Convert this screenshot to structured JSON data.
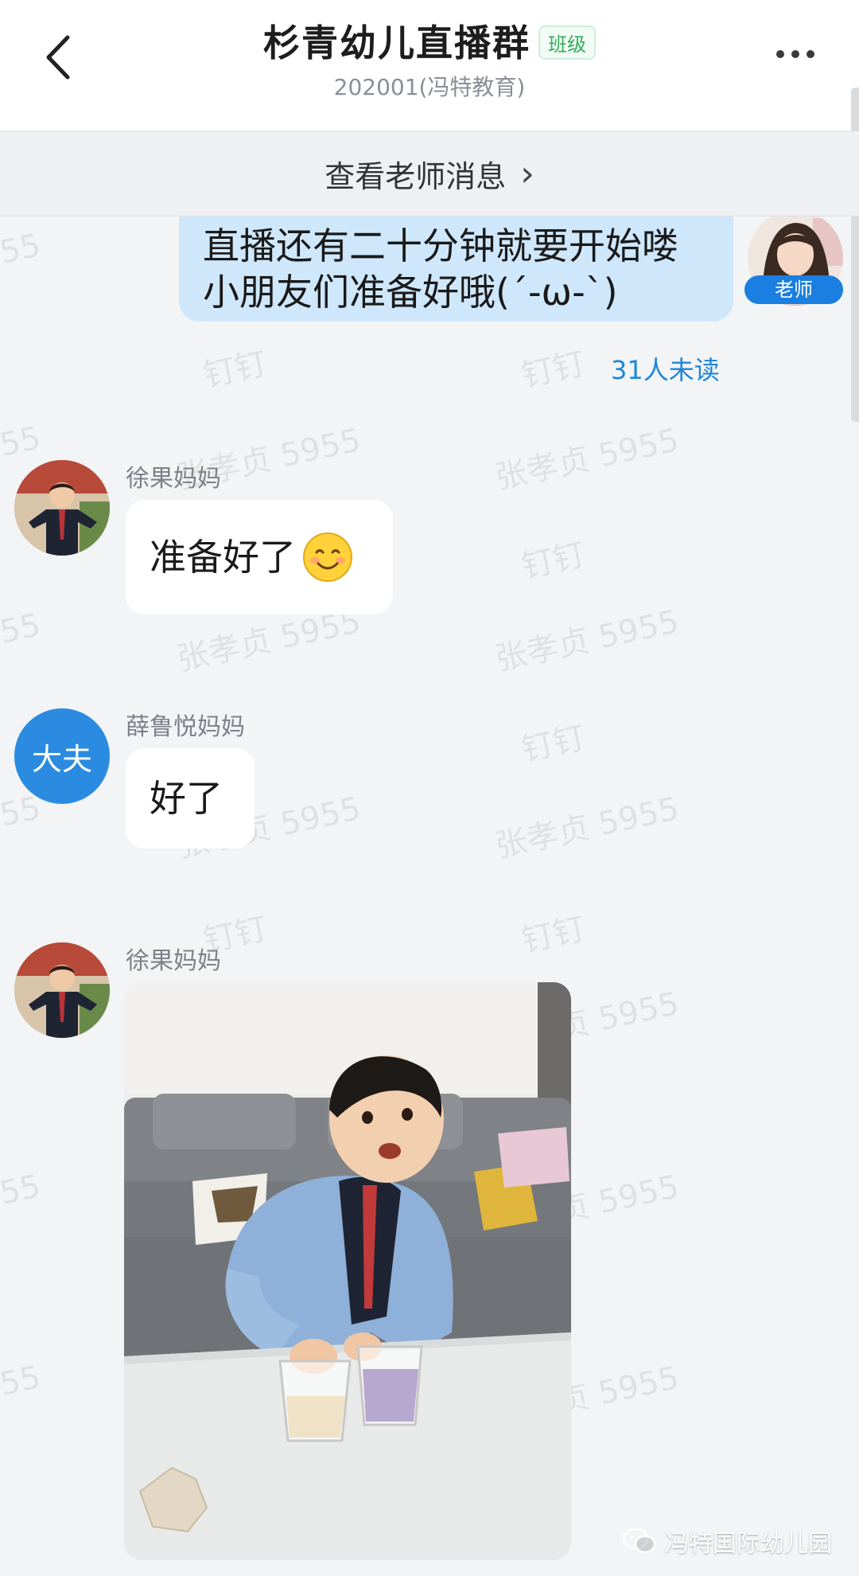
{
  "header": {
    "title": "杉青幼儿直播群",
    "badge": "班级",
    "subtitle": "202001(冯特教育)"
  },
  "teacher_bar": {
    "label": "查看老师消息",
    "chevron": "›"
  },
  "messages": [
    {
      "sender": "",
      "role_tag": "老师",
      "text": "直播还有二十分钟就要开始喽 小朋友们准备好哦(´-ω-`)",
      "unread": "31人未读",
      "avatar": "teacher-photo"
    },
    {
      "sender": "徐果妈妈",
      "text": "准备好了",
      "emoji": "smiling-face-icon",
      "avatar": "child-photo"
    },
    {
      "sender": "薛鲁悦妈妈",
      "avatar_text": "大夫",
      "text": "好了"
    },
    {
      "sender": "徐果妈妈",
      "avatar": "child-photo",
      "attachment": "photo-of-child-with-cups"
    }
  ],
  "watermarks": [
    "钉钉",
    "张孝贞 5955",
    "55"
  ],
  "brand": {
    "label": "冯特国际幼儿园"
  },
  "colors": {
    "accent": "#1f86d6",
    "my_bubble": "#cfe7fb",
    "badge_green": "#2fae5a",
    "avatar_blue": "#2b8be0"
  }
}
